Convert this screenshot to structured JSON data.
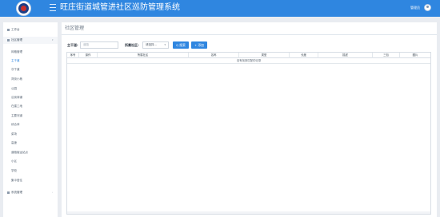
{
  "header": {
    "title": "旺庄街道城管进社区巡防管理系统",
    "user_name": "管理员",
    "logo_icon": "police-badge-icon",
    "menu_icon": "hamburger-icon",
    "color": "#2f86e0"
  },
  "sidebar": {
    "workbench": "工作台",
    "community_group": "社区管理",
    "items": [
      "网格管理",
      "主干道",
      "次干道",
      "背街小巷",
      "公园",
      "沿街商铺",
      "在建工地",
      "主要河道",
      "综合体",
      "菜场",
      "高速",
      "道路客运站点",
      "小区",
      "学校",
      "集中居住"
    ],
    "active_index": 1,
    "system_group": "系统管理"
  },
  "main": {
    "page_title": "社区管理",
    "filter": {
      "road_label": "主干道:",
      "road_placeholder": "道路",
      "community_label": "所属社区:",
      "community_value": "请选择..."
    },
    "buttons": {
      "search": "Q 搜索",
      "add": "+ 添加"
    },
    "table": {
      "columns": [
        "序号",
        "操作",
        "所属社区",
        "名称",
        "类型",
        "长度",
        "描述",
        "三包",
        "图片"
      ],
      "empty_message": "没有找到匹配的记录"
    }
  }
}
